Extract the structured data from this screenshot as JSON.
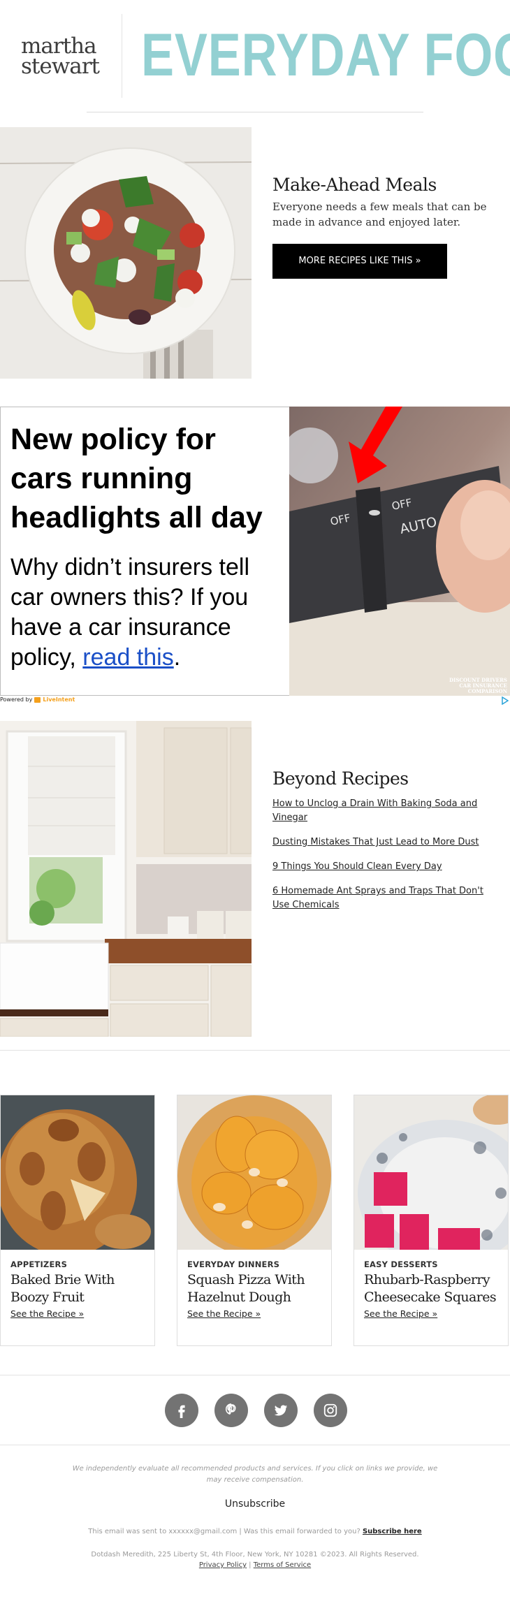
{
  "header": {
    "brand_line1": "martha",
    "brand_line2": "stewart",
    "publication": "EVERYDAY FOOD"
  },
  "feature": {
    "image_alt": "Quinoa salad bowl with tomatoes, feta, cucumber, olives and herbs",
    "title": "Make-Ahead Meals",
    "description": "Everyone needs a few meals that can be made in advance and enjoyed later.",
    "button_label": "MORE RECIPES LIKE THIS »"
  },
  "ad": {
    "headline": "New policy for cars running headlights all day",
    "body_prefix": "Why didn’t insurers tell car owners this? If you have a car insurance policy, ",
    "link_text": "read this",
    "body_suffix": ".",
    "image_alt": "Headlight control stalk with red arrow",
    "stalk_labels": [
      "OFF",
      "OFF",
      "AUTO"
    ],
    "caption_line1": "DISCOUNT DRIVERS",
    "caption_line2": "CAR INSURANCE",
    "caption_line3": "COMPARISON",
    "powered_by": "Powered by",
    "provider": "LiveIntent"
  },
  "beyond": {
    "image_alt": "White kitchen with farmhouse sink and wooden countertop",
    "title": "Beyond Recipes",
    "links": [
      {
        "label": "How to Unclog a Drain With Baking Soda and Vinegar"
      },
      {
        "label": "Dusting Mistakes That Just Lead to More Dust"
      },
      {
        "label": "9 Things You Should Clean Every Day"
      },
      {
        "label": "6 Homemade Ant Sprays and Traps That Don't Use Chemicals"
      }
    ]
  },
  "cards": [
    {
      "category": "APPETIZERS",
      "title": "Baked Brie With Boozy Fruit",
      "link": "See the Recipe »"
    },
    {
      "category": "EVERYDAY DINNERS",
      "title": "Squash Pizza With Hazelnut Dough",
      "link": "See the Recipe »"
    },
    {
      "category": "EASY DESSERTS",
      "title": "Rhubarb-Raspberry Cheesecake Squares",
      "link": "See the Recipe »"
    }
  ],
  "social": [
    {
      "name": "facebook-icon"
    },
    {
      "name": "pinterest-icon"
    },
    {
      "name": "twitter-icon"
    },
    {
      "name": "instagram-icon"
    }
  ],
  "footer": {
    "disclaimer": "We independently evaluate all recommended products and services. If you click on links we provide, we may receive compensation.",
    "unsubscribe": "Unsubscribe",
    "sent_to": "This email was sent to xxxxxx@gmail.com  |  Was this email forwarded to you? ",
    "subscribe_link": "Subscribe here",
    "address": "Dotdash Meredith, 225 Liberty St, 4th Floor, New York, NY 10281 ©2023. All Rights Reserved.",
    "privacy": "Privacy Policy",
    "separator": " | ",
    "terms": "Terms of Service"
  },
  "colors": {
    "brand_teal": "#93d0d2",
    "button_bg": "#000000",
    "ad_link": "#1a4fc7",
    "social_gray": "#737373",
    "liveintent_orange": "#f4a01c"
  }
}
